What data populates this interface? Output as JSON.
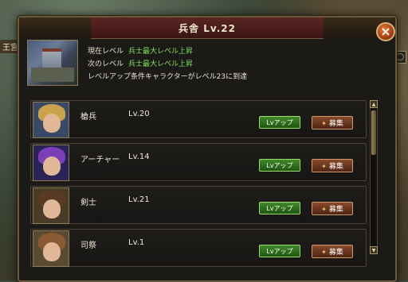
{
  "background": {
    "label": "王宮"
  },
  "dialog": {
    "title": "兵舎 Lv.22",
    "close_symbol": "×"
  },
  "info": {
    "current_label": "現在レベル",
    "current_value": "兵士最大レベル上昇",
    "next_label": "次のレベル",
    "next_value": "兵士最大レベル上昇",
    "condition": "レベルアップ条件キャラクターがレベル23に到達"
  },
  "buttons": {
    "level_up": "Lvアップ",
    "recruit": "募集"
  },
  "units": [
    {
      "name": "槍兵",
      "level": "Lv.20",
      "avatar_icon": "spearman-portrait",
      "hair": "#c9a24a",
      "bg": "#3a4a66"
    },
    {
      "name": "アーチャー",
      "level": "Lv.14",
      "avatar_icon": "archer-portrait",
      "hair": "#7b3fb8",
      "bg": "#2a2456"
    },
    {
      "name": "剣士",
      "level": "Lv.21",
      "avatar_icon": "swordsman-portrait",
      "hair": "#5a3a22",
      "bg": "#4a3a28"
    },
    {
      "name": "司祭",
      "level": "Lv.1",
      "avatar_icon": "priest-portrait",
      "hair": "#8a5a32",
      "bg": "#5a4a34"
    }
  ],
  "colors": {
    "accent_value": "#7fe05a",
    "title_bar": "#5a2624",
    "level_button": "#3f8a2a",
    "recruit_button": "#8a4a2a"
  }
}
